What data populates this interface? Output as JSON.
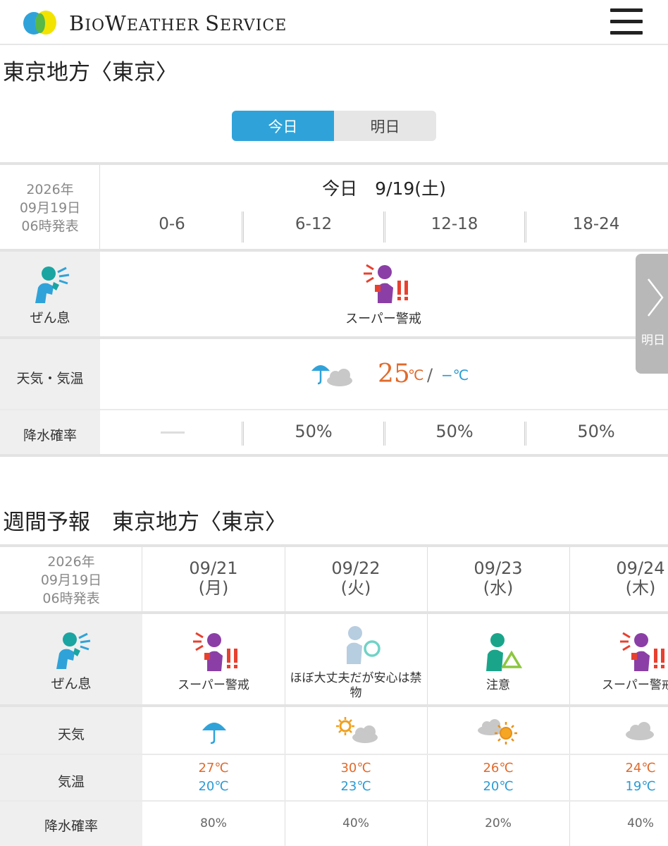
{
  "header": {
    "brand_big_b": "B",
    "brand_io": "IO",
    "brand_big_w": "W",
    "brand_eather": "EATHER ",
    "brand_big_s": "S",
    "brand_ervice": "ERVICE",
    "menu_icon": "hamburger-icon"
  },
  "region_title": "東京地方〈東京〉",
  "tabs": {
    "today": "今日",
    "tomorrow": "明日"
  },
  "today_table": {
    "issued": [
      "2026年",
      "09月19日",
      "06時発表"
    ],
    "date_label": "今日　9/19(土)",
    "periods": [
      "0-6",
      "6-12",
      "12-18",
      "18-24"
    ],
    "asthma_label": "ぜん息",
    "risk_text": "スーパー警戒",
    "weather_label": "天気・気温",
    "temp_max": "25",
    "temp_unit": "℃",
    "slash": "/",
    "temp_min": "−℃",
    "precip_label": "降水確率",
    "precip": [
      "50%",
      "50%",
      "50%"
    ],
    "next_day": "明日"
  },
  "weekly": {
    "title": "週間予報　東京地方〈東京〉",
    "issued": [
      "2026年",
      "09月19日",
      "06時発表"
    ],
    "asthma_label": "ぜん息",
    "weather_label": "天気",
    "temp_label": "気温",
    "precip_label": "降水確率",
    "days": [
      {
        "date": "09/21",
        "dow": "(月)",
        "risk": "スーパー警戒",
        "weather": "umbrella-icon",
        "hi": "27℃",
        "lo": "20℃",
        "precip": "80%"
      },
      {
        "date": "09/22",
        "dow": "(火)",
        "risk": "ほぼ大丈夫だが安心は禁物",
        "weather": "sun-cloud-icon",
        "hi": "30℃",
        "lo": "23℃",
        "precip": "40%"
      },
      {
        "date": "09/23",
        "dow": "(水)",
        "risk": "注意",
        "weather": "cloud-sun-icon",
        "hi": "26℃",
        "lo": "20℃",
        "precip": "20%"
      },
      {
        "date": "09/24",
        "dow": "(木)",
        "risk": "スーパー警戒",
        "weather": "cloud-icon",
        "hi": "24℃",
        "lo": "19℃",
        "precip": "40%"
      }
    ]
  },
  "colors": {
    "accent": "#2fa3d9",
    "warm": "#e06a2c",
    "cool": "#2a9bd3",
    "alert": "#e8402f",
    "purple": "#8b3fa6",
    "teal": "#1aa5a2"
  }
}
